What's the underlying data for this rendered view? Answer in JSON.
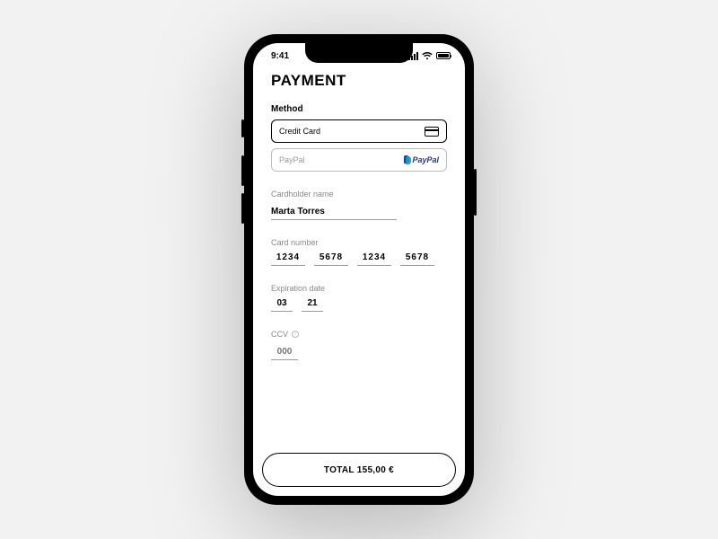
{
  "status": {
    "time": "9:41"
  },
  "title": "PAYMENT",
  "method": {
    "label": "Method",
    "credit_card": "Credit Card",
    "paypal": "PayPal",
    "paypal_brand": "PayPal"
  },
  "cardholder": {
    "label": "Cardholder name",
    "value": "Marta Torres"
  },
  "card_number": {
    "label": "Card number",
    "g1": "1234",
    "g2": "5678",
    "g3": "1234",
    "g4": "5678"
  },
  "expiration": {
    "label": "Expiration date",
    "month": "03",
    "year": "21"
  },
  "ccv": {
    "label": "CCV",
    "placeholder": "000"
  },
  "total": {
    "label": "TOTAL 155,00 €"
  }
}
